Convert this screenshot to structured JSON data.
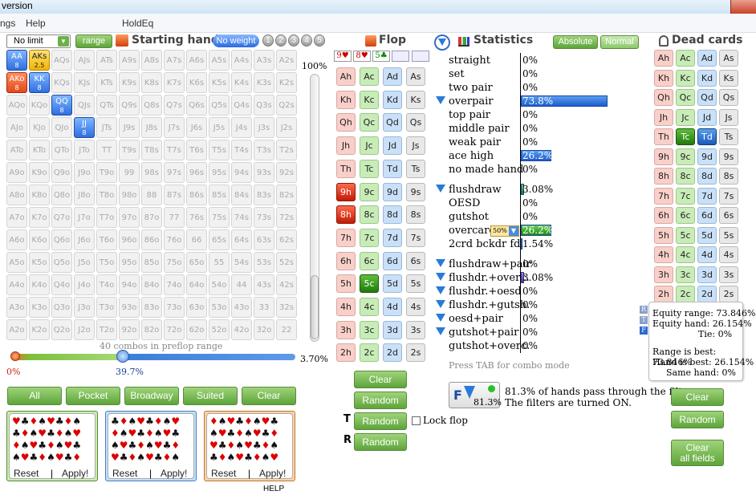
{
  "window": {
    "title": "version"
  },
  "menu": {
    "items": [
      "ngs",
      "Help",
      "HoldEq"
    ]
  },
  "range_panel": {
    "limit_select": "No limit",
    "range_button": "range",
    "title": "Starting hand",
    "weight_button": "No weight",
    "weight_levels": [
      "1",
      "2",
      "3",
      "4",
      "5"
    ],
    "slider_max_label": "100%",
    "combos_text": "40 combos in preflop range",
    "slider_left_label": "0%",
    "slider_mid_label": "39.7%",
    "slider_right_label": "3.70%",
    "quick_buttons": [
      "All",
      "Pocket",
      "Broadway",
      "Suited",
      "Clear"
    ],
    "reset_label": "Reset",
    "apply_label": "Apply!",
    "help_label": "HELP"
  },
  "hand_grid": {
    "rows": [
      [
        "AA",
        "AKs",
        "AQs",
        "AJs",
        "ATs",
        "A9s",
        "A8s",
        "A7s",
        "A6s",
        "A5s",
        "A4s",
        "A3s",
        "A2s"
      ],
      [
        "AKo",
        "KK",
        "KQs",
        "KJs",
        "KTs",
        "K9s",
        "K8s",
        "K7s",
        "K6s",
        "K5s",
        "K4s",
        "K3s",
        "K2s"
      ],
      [
        "AQo",
        "KQo",
        "QQ",
        "QJs",
        "QTs",
        "Q9s",
        "Q8s",
        "Q7s",
        "Q6s",
        "Q5s",
        "Q4s",
        "Q3s",
        "Q2s"
      ],
      [
        "AJo",
        "KJo",
        "QJo",
        "JJ",
        "JTs",
        "J9s",
        "J8s",
        "J7s",
        "J6s",
        "J5s",
        "J4s",
        "J3s",
        "J2s"
      ],
      [
        "ATo",
        "KTo",
        "QTo",
        "JTo",
        "TT",
        "T9s",
        "T8s",
        "T7s",
        "T6s",
        "T5s",
        "T4s",
        "T3s",
        "T2s"
      ],
      [
        "A9o",
        "K9o",
        "Q9o",
        "J9o",
        "T9o",
        "99",
        "98s",
        "97s",
        "96s",
        "95s",
        "94s",
        "93s",
        "92s"
      ],
      [
        "A8o",
        "K8o",
        "Q8o",
        "J8o",
        "T8o",
        "98o",
        "88",
        "87s",
        "86s",
        "85s",
        "84s",
        "83s",
        "82s"
      ],
      [
        "A7o",
        "K7o",
        "Q7o",
        "J7o",
        "T7o",
        "97o",
        "87o",
        "77",
        "76s",
        "75s",
        "74s",
        "73s",
        "72s"
      ],
      [
        "A6o",
        "K6o",
        "Q6o",
        "J6o",
        "T6o",
        "96o",
        "86o",
        "76o",
        "66",
        "65s",
        "64s",
        "63s",
        "62s"
      ],
      [
        "A5o",
        "K5o",
        "Q5o",
        "J5o",
        "T5o",
        "95o",
        "85o",
        "75o",
        "65o",
        "55",
        "54s",
        "53s",
        "52s"
      ],
      [
        "A4o",
        "K4o",
        "Q4o",
        "J4o",
        "T4o",
        "94o",
        "84o",
        "74o",
        "64o",
        "54o",
        "44",
        "43s",
        "42s"
      ],
      [
        "A3o",
        "K3o",
        "Q3o",
        "J3o",
        "T3o",
        "93o",
        "83o",
        "73o",
        "63o",
        "53o",
        "43o",
        "33",
        "32s"
      ],
      [
        "A2o",
        "K2o",
        "Q2o",
        "J2o",
        "T2o",
        "92o",
        "82o",
        "72o",
        "62o",
        "52o",
        "42o",
        "32o",
        "22"
      ]
    ],
    "selected": {
      "AA": "8",
      "AKs": "2.5",
      "AKo": "8",
      "KK": "8",
      "QQ": "8",
      "JJ": "8"
    }
  },
  "flop": {
    "title": "Flop",
    "board": [
      "9♥",
      "8♥",
      "5♣"
    ],
    "ranks": [
      "A",
      "K",
      "Q",
      "J",
      "T",
      "9",
      "8",
      "7",
      "6",
      "5",
      "4",
      "3",
      "2"
    ],
    "suits": [
      "h",
      "c",
      "d",
      "s"
    ],
    "selected": [
      "9h",
      "8h",
      "5c"
    ],
    "buttons": {
      "clear": "Clear",
      "random": "Random",
      "random_turn": "Random",
      "random_river": "Random"
    },
    "turn_letter": "T",
    "river_letter": "R",
    "lock_label": "Lock flop"
  },
  "statistics": {
    "title": "Statistics",
    "absolute_btn": "Absolute",
    "normal_btn": "Normal",
    "rows1": [
      {
        "label": "straight",
        "pct": "0%",
        "value": 0
      },
      {
        "label": "set",
        "pct": "0%",
        "value": 0
      },
      {
        "label": "two pair",
        "pct": "0%",
        "value": 0
      },
      {
        "label": "overpair",
        "pct": "73.8%",
        "value": 73.8
      },
      {
        "label": "top pair",
        "pct": "0%",
        "value": 0
      },
      {
        "label": "middle pair",
        "pct": "0%",
        "value": 0
      },
      {
        "label": "weak pair",
        "pct": "0%",
        "value": 0
      },
      {
        "label": "ace high",
        "pct": "26.2%",
        "value": 26.2
      },
      {
        "label": "no made hand",
        "pct": "0%",
        "value": 0
      }
    ],
    "rows2": [
      {
        "label": "flushdraw",
        "pct": "3.08%",
        "value": 3.08
      },
      {
        "label": "OESD",
        "pct": "0%",
        "value": 0
      },
      {
        "label": "gutshot",
        "pct": "0%",
        "value": 0
      },
      {
        "label": "overcards",
        "pct": "26.2%",
        "value": 26.2
      },
      {
        "label": "2crd bckdr fd.",
        "pct": "1.54%",
        "value": 1.54
      }
    ],
    "rows3": [
      {
        "label": "flushdraw+pair",
        "pct": "0%",
        "value": 0
      },
      {
        "label": "flushdr.+overc.",
        "pct": "3.08%",
        "value": 3.08
      },
      {
        "label": "flushdr.+oesd",
        "pct": "0%",
        "value": 0
      },
      {
        "label": "flushdr.+gutsh.",
        "pct": "0%",
        "value": 0
      },
      {
        "label": "oesd+pair",
        "pct": "0%",
        "value": 0
      },
      {
        "label": "gutshot+pair",
        "pct": "0%",
        "value": 0
      },
      {
        "label": "gutshot+overc.",
        "pct": "0%",
        "value": 0
      }
    ],
    "overcards_tag": "50%",
    "tab_hint": "Press TAB for combo mode",
    "filter_pct": "81.3%",
    "filter_letter": "F",
    "filter_line1": "81.3% of hands pass through the filters.",
    "filter_line2": "The filters are turned ON."
  },
  "dead_cards": {
    "title": "Dead cards",
    "selected": [
      "Tc",
      "Td"
    ],
    "clear_btn": "Clear",
    "random_btn": "Random",
    "clear_all_line1": "Clear",
    "clear_all_line2": "all fields"
  },
  "equity": {
    "side_letters": [
      "R",
      "T",
      "F"
    ],
    "equity_range": "Equity range: 73.846%",
    "equity_hand": "Equity hand: 26.154%",
    "tie": "Tie: 0%",
    "range_best": "Range is best: 73.846%",
    "hand_best": "Hand is best: 26.154%",
    "same_hand": "Same hand: 0%"
  }
}
